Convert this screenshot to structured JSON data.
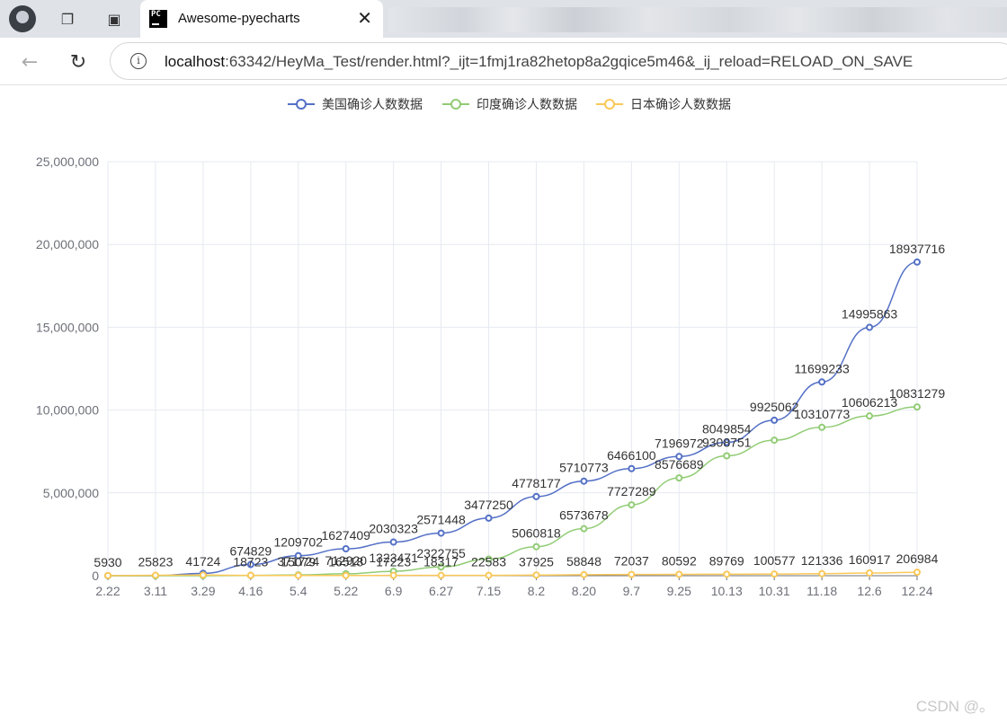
{
  "browser": {
    "tab_title": "Awesome-pyecharts",
    "tab_close": "✕",
    "url_host": "localhost",
    "url_rest": ":63342/HeyMa_Test/render.html?_ijt=1fmj1ra82hetop8a2gqice5m46&_ij_reload=RELOAD_ON_SAVE"
  },
  "watermark": "CSDN @。",
  "chart_data": {
    "type": "line",
    "categories": [
      "2.22",
      "3.11",
      "3.29",
      "4.16",
      "5.4",
      "5.22",
      "6.9",
      "6.27",
      "7.15",
      "8.2",
      "8.20",
      "9.7",
      "9.25",
      "10.13",
      "10.31",
      "11.18",
      "12.6",
      "12.24"
    ],
    "ylim": [
      0,
      25000000
    ],
    "yticks": [
      "0",
      "5,000,000",
      "10,000,000",
      "15,000,000",
      "20,000,000",
      "25,000,000"
    ],
    "legend_position": "top-center",
    "grid": true,
    "series": [
      {
        "name": "美国确诊人数数据",
        "color": "#5470c6",
        "values": [
          30,
          1000,
          142000,
          674829,
          1209702,
          1627409,
          2030323,
          2571448,
          3477250,
          4778177,
          5710773,
          6466100,
          7196972,
          8049854,
          9387755,
          11699233,
          14995863,
          18937716
        ]
      },
      {
        "name": "印度确诊人数数据",
        "color": "#91cc75",
        "values": [
          3,
          60,
          1071,
          13387,
          49436,
          118447,
          267046,
          528859,
          1005637,
          1751919,
          2836925,
          4280422,
          5903932,
          7239389,
          8184082,
          8958483,
          9644222,
          10187850
        ]
      },
      {
        "name": "日本确诊人数数据",
        "color": "#fac858",
        "values": [
          5930,
          25823,
          41724,
          18723,
          15079,
          16518,
          17223,
          18317,
          22583,
          37925,
          58848,
          72037,
          80592,
          89769,
          100577,
          121336,
          160917,
          206984
        ]
      }
    ],
    "data_labels": [
      {
        "series": 0,
        "text": "18937716",
        "x_index": 17
      },
      {
        "series": 0,
        "text": "14995863",
        "x_index": 16
      },
      {
        "series": 0,
        "text": "11699233",
        "x_index": 15
      },
      {
        "series": 0,
        "text": "9925062",
        "x_index": 14
      },
      {
        "series": 0,
        "text": "8049854",
        "x_index": 13
      },
      {
        "series": 0,
        "text": "7196972",
        "x_index": 12
      },
      {
        "series": 0,
        "text": "6466100",
        "x_index": 11
      },
      {
        "series": 0,
        "text": "5710773",
        "x_index": 10
      },
      {
        "series": 0,
        "text": "4778177",
        "x_index": 9
      },
      {
        "series": 0,
        "text": "3477250",
        "x_index": 8
      },
      {
        "series": 0,
        "text": "2571448",
        "x_index": 7
      },
      {
        "series": 0,
        "text": "2030323",
        "x_index": 6
      },
      {
        "series": 0,
        "text": "1627409",
        "x_index": 5
      },
      {
        "series": 0,
        "text": "1209702",
        "x_index": 4
      },
      {
        "series": 0,
        "text": "674829",
        "x_index": 3
      },
      {
        "series": 1,
        "text": "10831279",
        "x_index": 17
      },
      {
        "series": 1,
        "text": "10606213",
        "x_index": 16
      },
      {
        "series": 1,
        "text": "10310773",
        "x_index": 15
      },
      {
        "series": 1,
        "text": "9308751",
        "x_index": 13
      },
      {
        "series": 1,
        "text": "8576689",
        "x_index": 12
      },
      {
        "series": 1,
        "text": "7727289",
        "x_index": 11
      },
      {
        "series": 1,
        "text": "6573678",
        "x_index": 10
      },
      {
        "series": 1,
        "text": "5060818",
        "x_index": 9
      },
      {
        "series": 1,
        "text": "2322755",
        "x_index": 7
      },
      {
        "series": 1,
        "text": "1323471",
        "x_index": 6
      },
      {
        "series": 1,
        "text": "712920",
        "x_index": 5
      },
      {
        "series": 1,
        "text": "371724",
        "x_index": 4
      }
    ]
  }
}
